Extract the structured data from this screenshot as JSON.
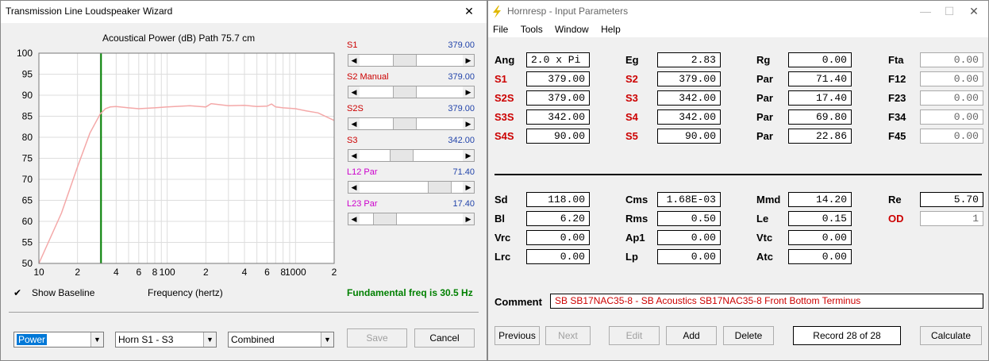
{
  "wizard": {
    "title": "Transmission Line Loudspeaker Wizard",
    "chart_title": "Acoustical Power (dB)   Path 75.7 cm",
    "x_axis_label": "Frequency (hertz)",
    "fund_freq": "Fundamental freq is 30.5 Hz",
    "show_baseline": "Show Baseline",
    "sliders": [
      {
        "label": "S1",
        "value": "379.00",
        "label_color": "#cc0000",
        "pos": 0.42
      },
      {
        "label": "S2  Manual",
        "value": "379.00",
        "label_color": "#cc0000",
        "pos": 0.42
      },
      {
        "label": "S2S",
        "value": "379.00",
        "label_color": "#cc0000",
        "pos": 0.42
      },
      {
        "label": "S3",
        "value": "342.00",
        "label_color": "#cc0000",
        "pos": 0.38
      },
      {
        "label": "L12  Par",
        "value": "71.40",
        "label_color": "#cc00cc",
        "pos": 0.86
      },
      {
        "label": "L23  Par",
        "value": "17.40",
        "label_color": "#cc00cc",
        "pos": 0.17
      }
    ],
    "combo_type": "Power",
    "combo_horn": "Horn S1 - S3",
    "combo_mode": "Combined",
    "save": "Save",
    "cancel": "Cancel"
  },
  "chart_data": {
    "type": "line",
    "title": "Acoustical Power (dB)   Path 75.7 cm",
    "xlabel": "Frequency (hertz)",
    "ylabel": "",
    "xscale": "log",
    "xlim": [
      10,
      2000
    ],
    "ylim": [
      50,
      100
    ],
    "yticks": [
      50,
      55,
      60,
      65,
      70,
      75,
      80,
      85,
      90,
      95,
      100
    ],
    "xtick_labels": [
      {
        "f": 10,
        "t": "10"
      },
      {
        "f": 20,
        "t": "2"
      },
      {
        "f": 40,
        "t": "4"
      },
      {
        "f": 60,
        "t": "6"
      },
      {
        "f": 80,
        "t": "8"
      },
      {
        "f": 100,
        "t": "100"
      },
      {
        "f": 200,
        "t": "2"
      },
      {
        "f": 400,
        "t": "4"
      },
      {
        "f": 600,
        "t": "6"
      },
      {
        "f": 800,
        "t": "8"
      },
      {
        "f": 1000,
        "t": "1000"
      },
      {
        "f": 2000,
        "t": "2"
      }
    ],
    "marker_freq": 30.5,
    "series": [
      {
        "color": "#f4a8a8",
        "x": [
          10,
          15,
          20,
          25,
          30,
          33,
          36,
          40,
          50,
          60,
          80,
          100,
          150,
          200,
          220,
          300,
          400,
          500,
          600,
          650,
          700,
          800,
          1000,
          1200,
          1500,
          2000
        ],
        "y": [
          50,
          62,
          73,
          81,
          85.5,
          86.8,
          87.2,
          87.3,
          87.0,
          86.8,
          87.0,
          87.2,
          87.5,
          87.2,
          88.0,
          87.5,
          87.6,
          87.3,
          87.4,
          87.9,
          87.2,
          87.0,
          86.8,
          86.3,
          85.8,
          84.0
        ]
      }
    ]
  },
  "hornresp": {
    "title": "Hornresp - Input Parameters",
    "menu": [
      "File",
      "Tools",
      "Window",
      "Help"
    ],
    "rows1": [
      [
        {
          "l": "Ang",
          "v": "2.0 x Pi",
          "red": false,
          "left": true
        },
        {
          "l": "Eg",
          "v": "2.83",
          "red": false
        },
        {
          "l": "Rg",
          "v": "0.00",
          "red": false
        },
        {
          "l": "Fta",
          "v": "0.00",
          "red": false,
          "grey": true
        }
      ],
      [
        {
          "l": "S1",
          "v": "379.00",
          "red": true
        },
        {
          "l": "S2",
          "v": "379.00",
          "red": true
        },
        {
          "l": "Par",
          "v": "71.40",
          "red": false
        },
        {
          "l": "F12",
          "v": "0.00",
          "red": false,
          "grey": true
        }
      ],
      [
        {
          "l": "S2S",
          "v": "379.00",
          "red": true
        },
        {
          "l": "S3",
          "v": "342.00",
          "red": true
        },
        {
          "l": "Par",
          "v": "17.40",
          "red": false
        },
        {
          "l": "F23",
          "v": "0.00",
          "red": false,
          "grey": true
        }
      ],
      [
        {
          "l": "S3S",
          "v": "342.00",
          "red": true
        },
        {
          "l": "S4",
          "v": "342.00",
          "red": true
        },
        {
          "l": "Par",
          "v": "69.80",
          "red": false
        },
        {
          "l": "F34",
          "v": "0.00",
          "red": false,
          "grey": true
        }
      ],
      [
        {
          "l": "S4S",
          "v": "90.00",
          "red": true
        },
        {
          "l": "S5",
          "v": "90.00",
          "red": true
        },
        {
          "l": "Par",
          "v": "22.86",
          "red": false
        },
        {
          "l": "F45",
          "v": "0.00",
          "red": false,
          "grey": true
        }
      ]
    ],
    "rows2": [
      [
        {
          "l": "Sd",
          "v": "118.00"
        },
        {
          "l": "Cms",
          "v": "1.68E-03"
        },
        {
          "l": "Mmd",
          "v": "14.20"
        },
        {
          "l": "Re",
          "v": "5.70"
        }
      ],
      [
        {
          "l": "Bl",
          "v": "6.20"
        },
        {
          "l": "Rms",
          "v": "0.50"
        },
        {
          "l": "Le",
          "v": "0.15"
        },
        {
          "l": "OD",
          "v": "1",
          "red": true,
          "grey": true
        }
      ],
      [
        {
          "l": "Vrc",
          "v": "0.00"
        },
        {
          "l": "Ap1",
          "v": "0.00"
        },
        {
          "l": "Vtc",
          "v": "0.00"
        }
      ],
      [
        {
          "l": "Lrc",
          "v": "0.00"
        },
        {
          "l": "Lp",
          "v": "0.00"
        },
        {
          "l": "Atc",
          "v": "0.00"
        }
      ]
    ],
    "comment_label": "Comment",
    "comment": "SB SB17NAC35-8 - SB Acoustics SB17NAC35-8 Front Bottom Terminus",
    "btn_previous": "Previous",
    "btn_next": "Next",
    "btn_edit": "Edit",
    "btn_add": "Add",
    "btn_delete": "Delete",
    "record": "Record 28 of 28",
    "btn_calculate": "Calculate"
  }
}
